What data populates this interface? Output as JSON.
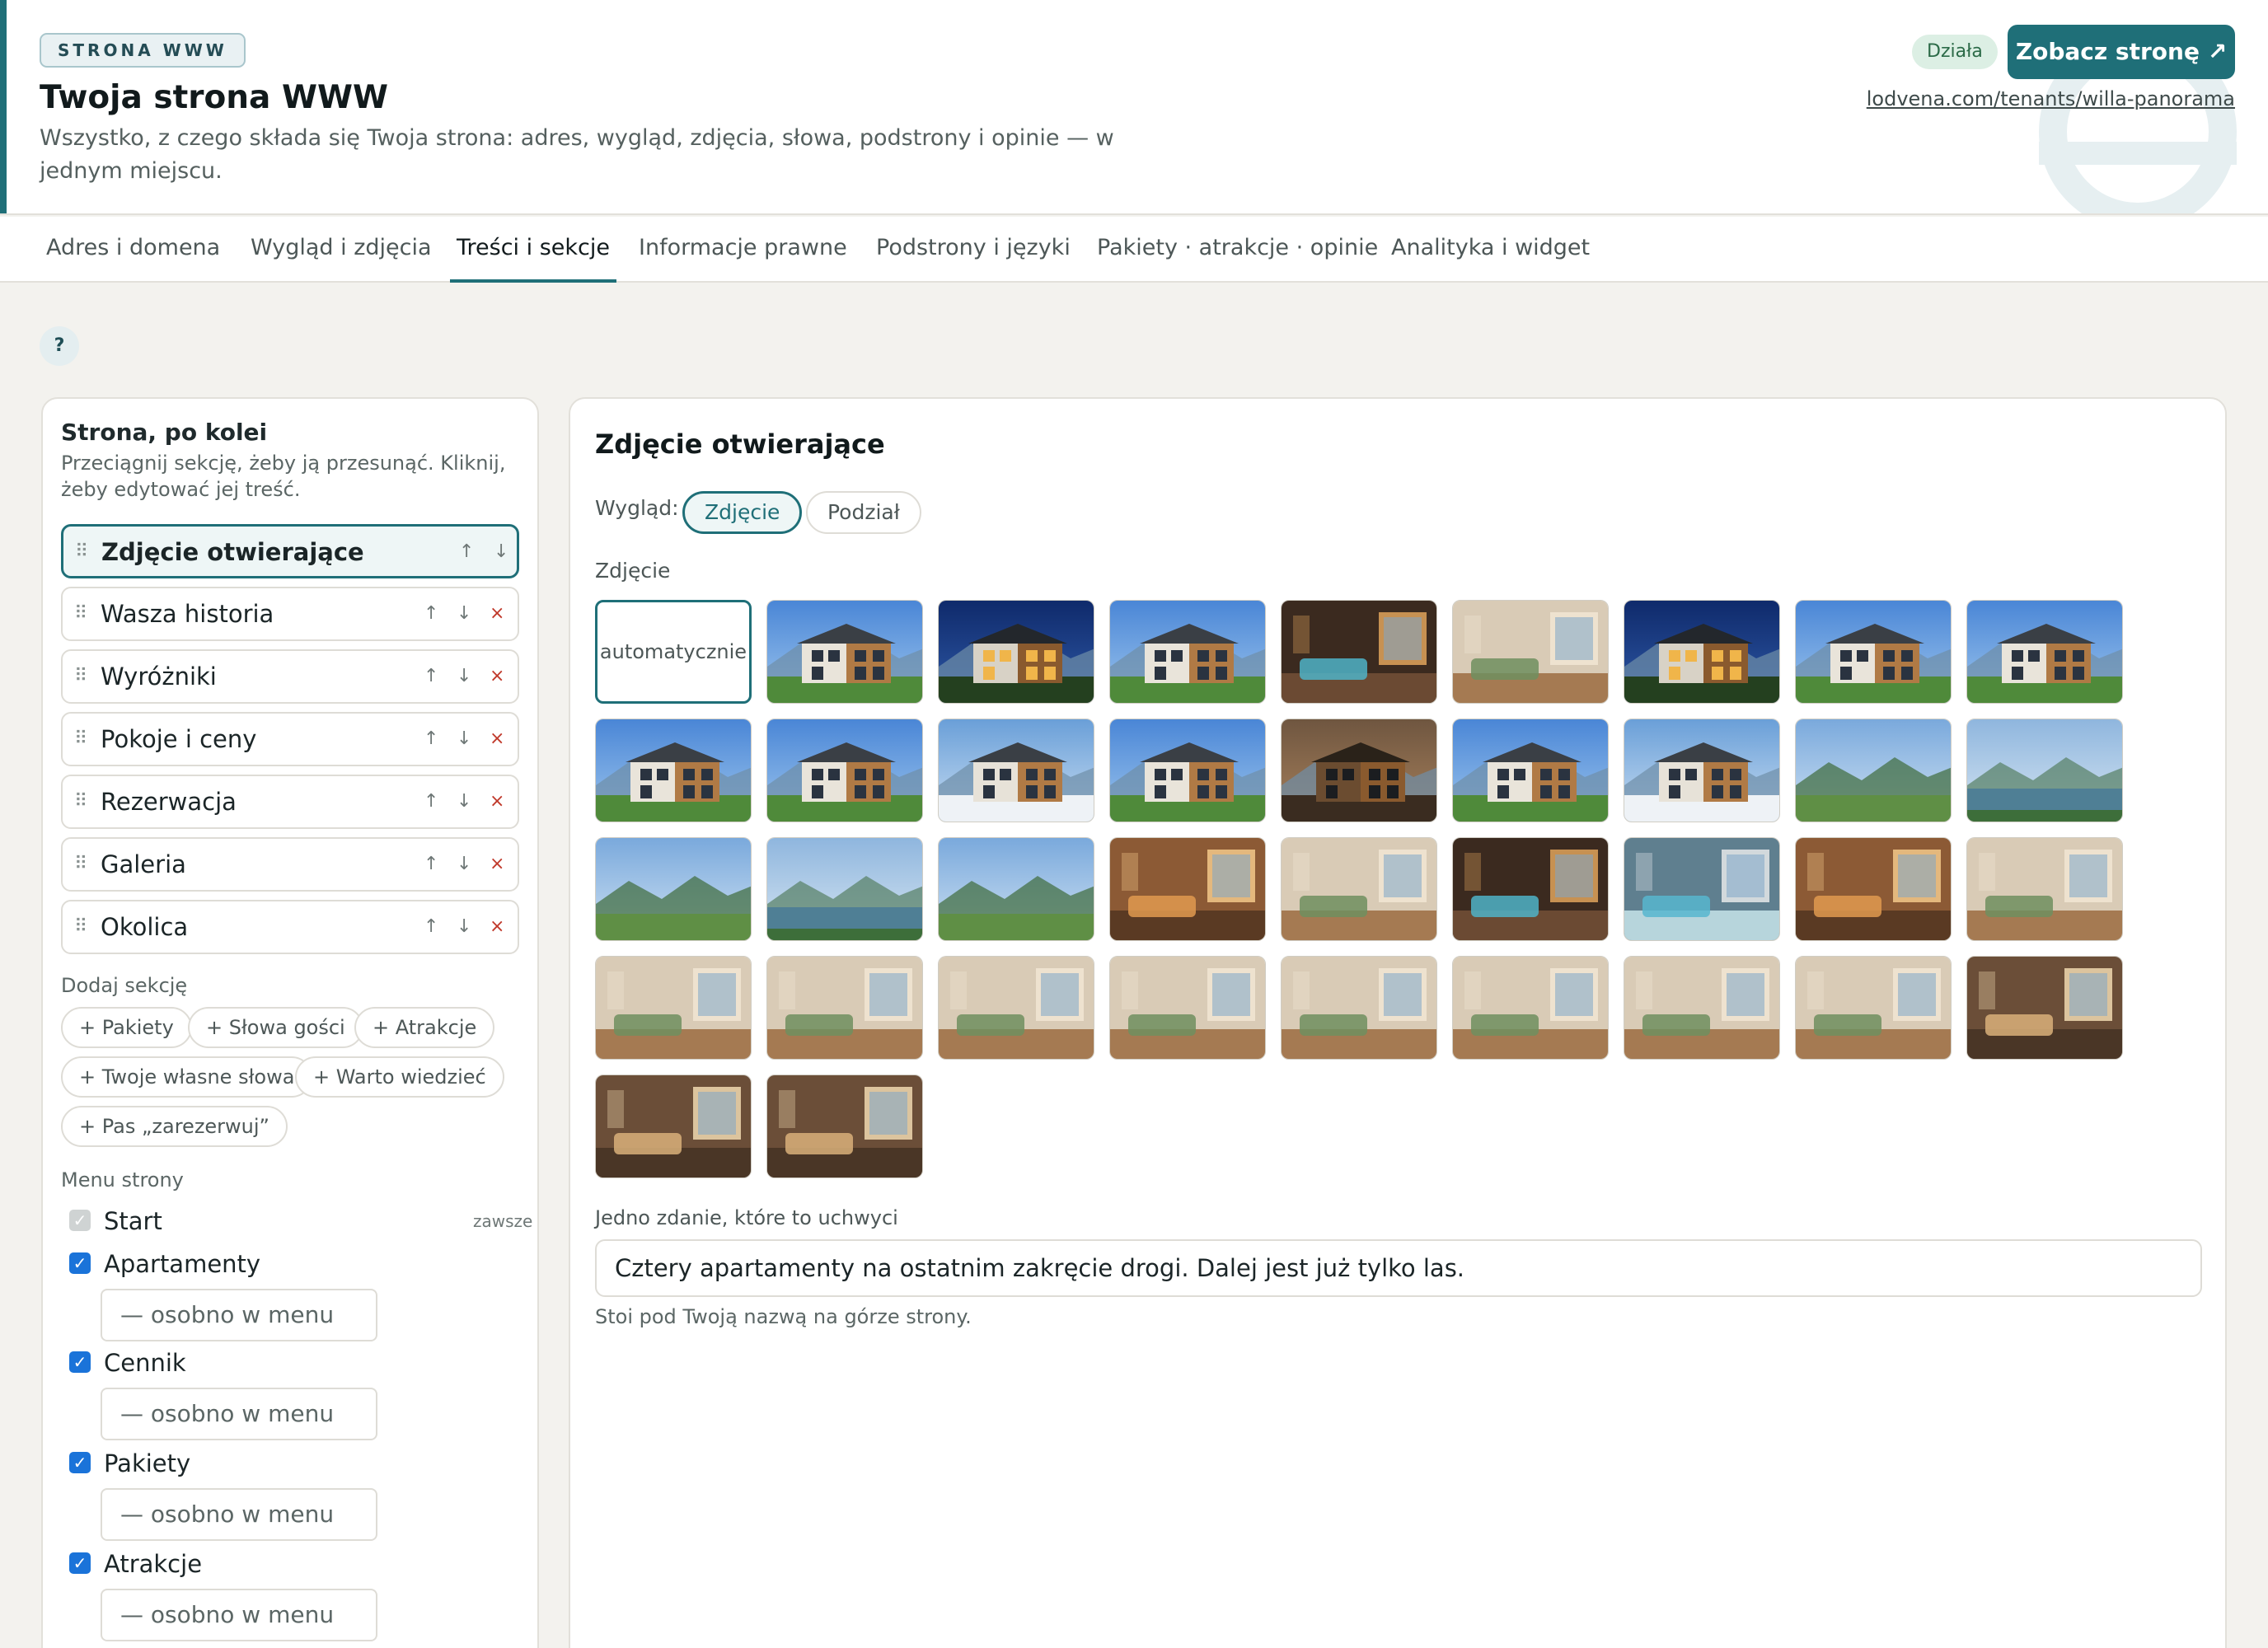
{
  "header": {
    "kicker": "STRONA WWW",
    "title": "Twoja strona WWW",
    "subtitle": "Wszystko, z czego składa się Twoja strona: adres, wygląd, zdjęcia, słowa, podstrony i opinie — w jednym miejscu.",
    "status": "Działa",
    "view_button": "Zobacz stronę ↗",
    "url": "lodvena.com/tenants/willa-panorama"
  },
  "tabs": [
    {
      "label": "Adres i domena"
    },
    {
      "label": "Wygląd i zdjęcia"
    },
    {
      "label": "Treści i sekcje",
      "active": true
    },
    {
      "label": "Informacje prawne"
    },
    {
      "label": "Podstrony i języki"
    },
    {
      "label": "Pakiety · atrakcje · opinie"
    },
    {
      "label": "Analityka i widget"
    }
  ],
  "help_label": "?",
  "left": {
    "title": "Strona, po kolei",
    "subtitle": "Przeciągnij sekcję, żeby ją przesunąć. Kliknij, żeby edytować jej treść.",
    "sections": [
      {
        "name": "Zdjęcie otwierające",
        "active": true
      },
      {
        "name": "Wasza historia"
      },
      {
        "name": "Wyróżniki"
      },
      {
        "name": "Pokoje i ceny"
      },
      {
        "name": "Rezerwacja"
      },
      {
        "name": "Galeria"
      },
      {
        "name": "Okolica"
      }
    ],
    "controls": {
      "grip": "⠿",
      "up": "↑",
      "down": "↓",
      "remove": "×"
    },
    "add_label": "Dodaj sekcję",
    "add_chips": [
      "+ Pakiety",
      "+ Słowa gości",
      "+ Atrakcje",
      "+ Twoje własne słowa",
      "+ Warto wiedzieć",
      "+ Pas „zarezerwuj”"
    ],
    "menu_label": "Menu strony",
    "menu": [
      {
        "label": "Start",
        "checked": true,
        "disabled": true,
        "note": "zawsze"
      },
      {
        "label": "Apartamenty",
        "checked": true,
        "select": "— osobno w menu"
      },
      {
        "label": "Cennik",
        "checked": true,
        "select": "— osobno w menu"
      },
      {
        "label": "Pakiety",
        "checked": true,
        "select": "— osobno w menu"
      },
      {
        "label": "Atrakcje",
        "checked": true,
        "select": "— osobno w menu"
      }
    ]
  },
  "main": {
    "title": "Zdjęcie otwierające",
    "look_label": "Wygląd:",
    "look_options": [
      {
        "label": "Zdjęcie",
        "selected": true
      },
      {
        "label": "Podział"
      }
    ],
    "photo_label": "Zdjęcie",
    "auto_label": "automatycznie",
    "photos": [
      {
        "name": "house-day-photo",
        "scene": "house-day"
      },
      {
        "name": "house-night-photo",
        "scene": "house-night"
      },
      {
        "name": "house-dusk-photo",
        "scene": "house-day"
      },
      {
        "name": "spa-interior-photo",
        "scene": "spa"
      },
      {
        "name": "game-room-photo",
        "scene": "interior"
      },
      {
        "name": "house-night-photo",
        "scene": "house-night"
      },
      {
        "name": "house-garden-photo",
        "scene": "house-day"
      },
      {
        "name": "house-wood-photo",
        "scene": "house-day"
      },
      {
        "name": "house-front-photo",
        "scene": "house-day"
      },
      {
        "name": "house-side-photo",
        "scene": "house-day"
      },
      {
        "name": "house-winter-photo",
        "scene": "winter"
      },
      {
        "name": "house-path-photo",
        "scene": "house-day"
      },
      {
        "name": "balcony-photo",
        "scene": "house-dark"
      },
      {
        "name": "house-mountain-photo",
        "scene": "house-day"
      },
      {
        "name": "ski-slope-photo",
        "scene": "winter"
      },
      {
        "name": "mountain-hike-photo",
        "scene": "mountain"
      },
      {
        "name": "kayak-photo",
        "scene": "lake"
      },
      {
        "name": "horse-riding-photo",
        "scene": "mountain"
      },
      {
        "name": "lake-view-photo",
        "scene": "lake"
      },
      {
        "name": "cycling-photo",
        "scene": "mountain"
      },
      {
        "name": "dining-photo",
        "scene": "warm"
      },
      {
        "name": "terrace-wine-photo",
        "scene": "interior"
      },
      {
        "name": "jacuzzi-photo",
        "scene": "spa"
      },
      {
        "name": "pool-photo",
        "scene": "pool"
      },
      {
        "name": "bedroom-warm-photo",
        "scene": "warm"
      },
      {
        "name": "breakfast-photo",
        "scene": "interior"
      },
      {
        "name": "living-room-photo",
        "scene": "interior"
      },
      {
        "name": "living-room-photo",
        "scene": "interior"
      },
      {
        "name": "living-room-photo",
        "scene": "interior"
      },
      {
        "name": "living-room-photo",
        "scene": "interior"
      },
      {
        "name": "bedroom-photo",
        "scene": "interior"
      },
      {
        "name": "bedroom-photo",
        "scene": "interior"
      },
      {
        "name": "bedroom-photo",
        "scene": "interior"
      },
      {
        "name": "bedroom-photo",
        "scene": "interior"
      },
      {
        "name": "bathroom-photo",
        "scene": "bath"
      },
      {
        "name": "bathroom-photo",
        "scene": "bath"
      },
      {
        "name": "bathroom-photo",
        "scene": "bath"
      }
    ],
    "sentence_label": "Jedno zdanie, które to uchwyci",
    "sentence_value": "Cztery apartamenty na ostatnim zakręcie drogi. Dalej jest już tylko las.",
    "hint": "Stoi pod Twoją nazwą na górze strony."
  },
  "colors": {
    "accent": "#1f6f78",
    "checkbox": "#1a73d9",
    "danger": "#c0392b"
  }
}
